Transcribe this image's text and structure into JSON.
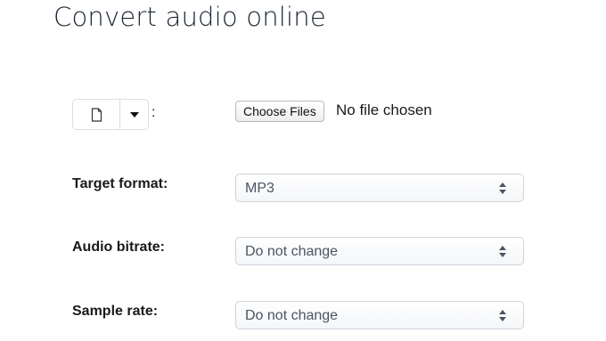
{
  "page": {
    "title": "Convert audio online"
  },
  "upload": {
    "file_icon": "file-icon",
    "caret_icon": "caret-down-icon",
    "colon": ":",
    "choose_label": "Choose Files",
    "status_text": "No file chosen"
  },
  "fields": {
    "target_format": {
      "label": "Target format:",
      "value": "MP3"
    },
    "audio_bitrate": {
      "label": "Audio bitrate:",
      "value": "Do not change"
    },
    "sample_rate": {
      "label": "Sample rate:",
      "value": "Do not change"
    }
  },
  "colors": {
    "title": "#1b2633",
    "border": "#cdd4dc",
    "select_text": "#4a5563"
  }
}
